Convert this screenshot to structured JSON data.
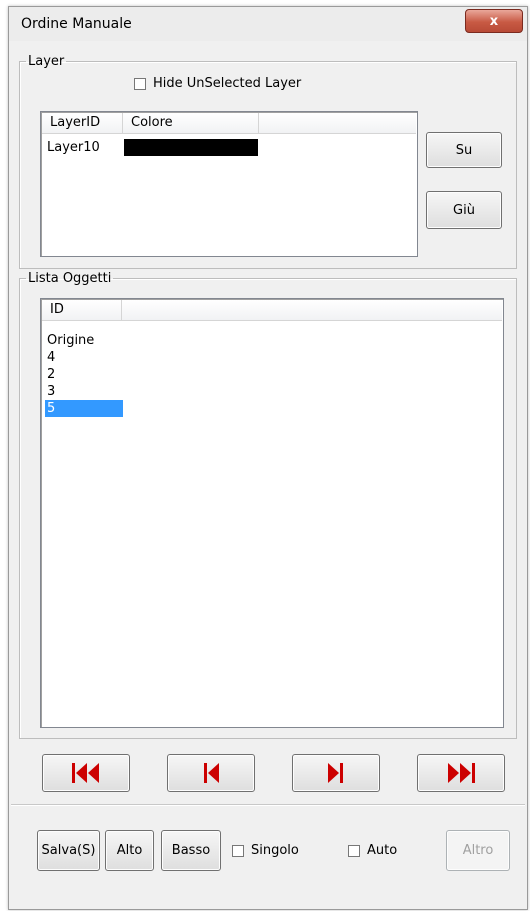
{
  "window": {
    "title": "Ordine Manuale",
    "close_glyph": "x"
  },
  "layer_group": {
    "legend": "Layer",
    "hide_checkbox_label": "Hide UnSelected Layer",
    "hide_checked": false,
    "columns": [
      "LayerID",
      "Colore"
    ],
    "rows": [
      {
        "id": "Layer10",
        "color": "#000000"
      }
    ],
    "up_label": "Su",
    "down_label": "Giù"
  },
  "objects_group": {
    "legend": "Lista Oggetti",
    "column": "ID",
    "items": [
      "Origine",
      "4",
      "2",
      "3",
      "5"
    ],
    "selected_index": 4
  },
  "navigation": {
    "first_icon": "skip-first-icon",
    "prev_icon": "step-back-icon",
    "next_icon": "step-forward-icon",
    "last_icon": "skip-last-icon",
    "icon_color": "#cc0000"
  },
  "bottom_bar": {
    "save_label": "Salva(S)",
    "top_label": "Alto",
    "bottom_label": "Basso",
    "single_label": "Singolo",
    "single_checked": false,
    "auto_label": "Auto",
    "auto_checked": false,
    "other_label": "Altro",
    "other_disabled": true
  }
}
